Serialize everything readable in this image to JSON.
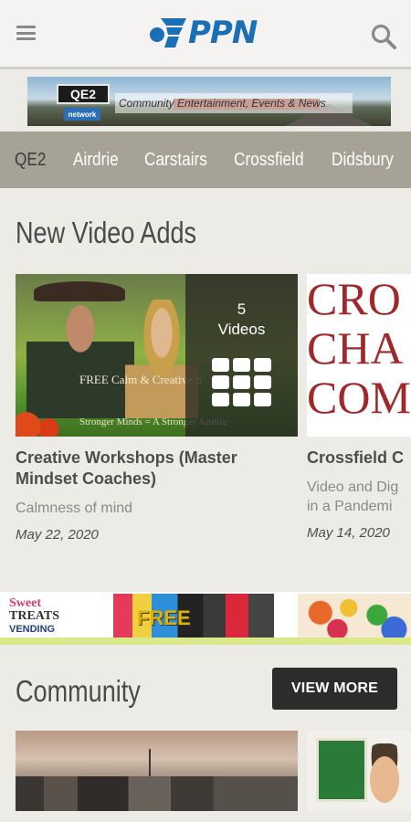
{
  "header": {
    "logo_text": "PPN",
    "menu_icon": "hamburger-menu-icon",
    "search_icon": "search-icon",
    "brand_color": "#1a6fb5"
  },
  "top_banner": {
    "badge": "QE2",
    "badge_sub": "network",
    "tagline": "Community Entertainment, Events & News"
  },
  "tabs": [
    {
      "label": "QE2",
      "active": true
    },
    {
      "label": "Airdrie",
      "active": false
    },
    {
      "label": "Carstairs",
      "active": false
    },
    {
      "label": "Crossfield",
      "active": false
    },
    {
      "label": "Didsbury",
      "active": false
    }
  ],
  "new_video_adds": {
    "title": "New Video Adds",
    "cards": [
      {
        "title": "Creative Workshops (Master Mindset Coaches)",
        "description": "Calmness of mind",
        "date": "May 22, 2020",
        "overlay_count": "5",
        "overlay_label": "Videos",
        "thumb_text": "FREE Calm & Creative S",
        "thumb_bottom_text": "Stronger Minds = A Stronger Airdrie"
      },
      {
        "title": "Crossfield C",
        "description_line1": "Video and Dig",
        "description_line2": "in a Pandemi",
        "date": "May 14, 2020",
        "thumb_lines": [
          "CRO",
          "CHA",
          "COM"
        ]
      }
    ]
  },
  "ad": {
    "brand_line1": "Sweet",
    "brand_line2": "TREATS",
    "brand_line3": "VENDING",
    "free_text": "FREE"
  },
  "community": {
    "title": "Community",
    "view_more_label": "VIEW MORE"
  }
}
